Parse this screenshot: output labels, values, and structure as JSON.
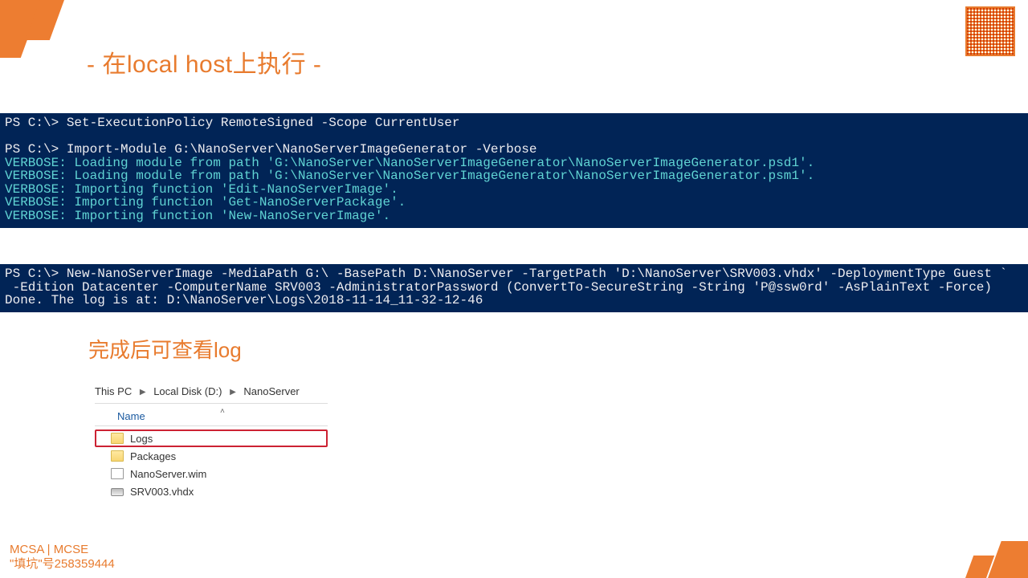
{
  "title": "- 在local host上执行 -",
  "ps1": {
    "l1": "PS C:\\> Set-ExecutionPolicy RemoteSigned -Scope CurrentUser",
    "l2": "",
    "l3": "PS C:\\> Import-Module G:\\NanoServer\\NanoServerImageGenerator -Verbose",
    "v1": "VERBOSE: Loading module from path 'G:\\NanoServer\\NanoServerImageGenerator\\NanoServerImageGenerator.psd1'.",
    "v2": "VERBOSE: Loading module from path 'G:\\NanoServer\\NanoServerImageGenerator\\NanoServerImageGenerator.psm1'.",
    "v3": "VERBOSE: Importing function 'Edit-NanoServerImage'.",
    "v4": "VERBOSE: Importing function 'Get-NanoServerPackage'.",
    "v5": "VERBOSE: Importing function 'New-NanoServerImage'."
  },
  "ps2": {
    "l1": "PS C:\\> New-NanoServerImage -MediaPath G:\\ -BasePath D:\\NanoServer -TargetPath 'D:\\NanoServer\\SRV003.vhdx' -DeploymentType Guest `",
    "l2": " -Edition Datacenter -ComputerName SRV003 -AdministratorPassword (ConvertTo-SecureString -String 'P@ssw0rd' -AsPlainText -Force)",
    "l3": "Done. The log is at: D:\\NanoServer\\Logs\\2018-11-14_11-32-12-46"
  },
  "subtitle": "完成后可查看log",
  "explorer": {
    "crumbs": [
      "This PC",
      "Local Disk (D:)",
      "NanoServer"
    ],
    "header": "Name",
    "items": [
      {
        "name": "Logs",
        "type": "folder"
      },
      {
        "name": "Packages",
        "type": "folder"
      },
      {
        "name": "NanoServer.wim",
        "type": "file"
      },
      {
        "name": "SRV003.vhdx",
        "type": "disk"
      }
    ]
  },
  "footer": {
    "l1": "MCSA | MCSE",
    "l2": "\"填坑\"号258359444"
  }
}
